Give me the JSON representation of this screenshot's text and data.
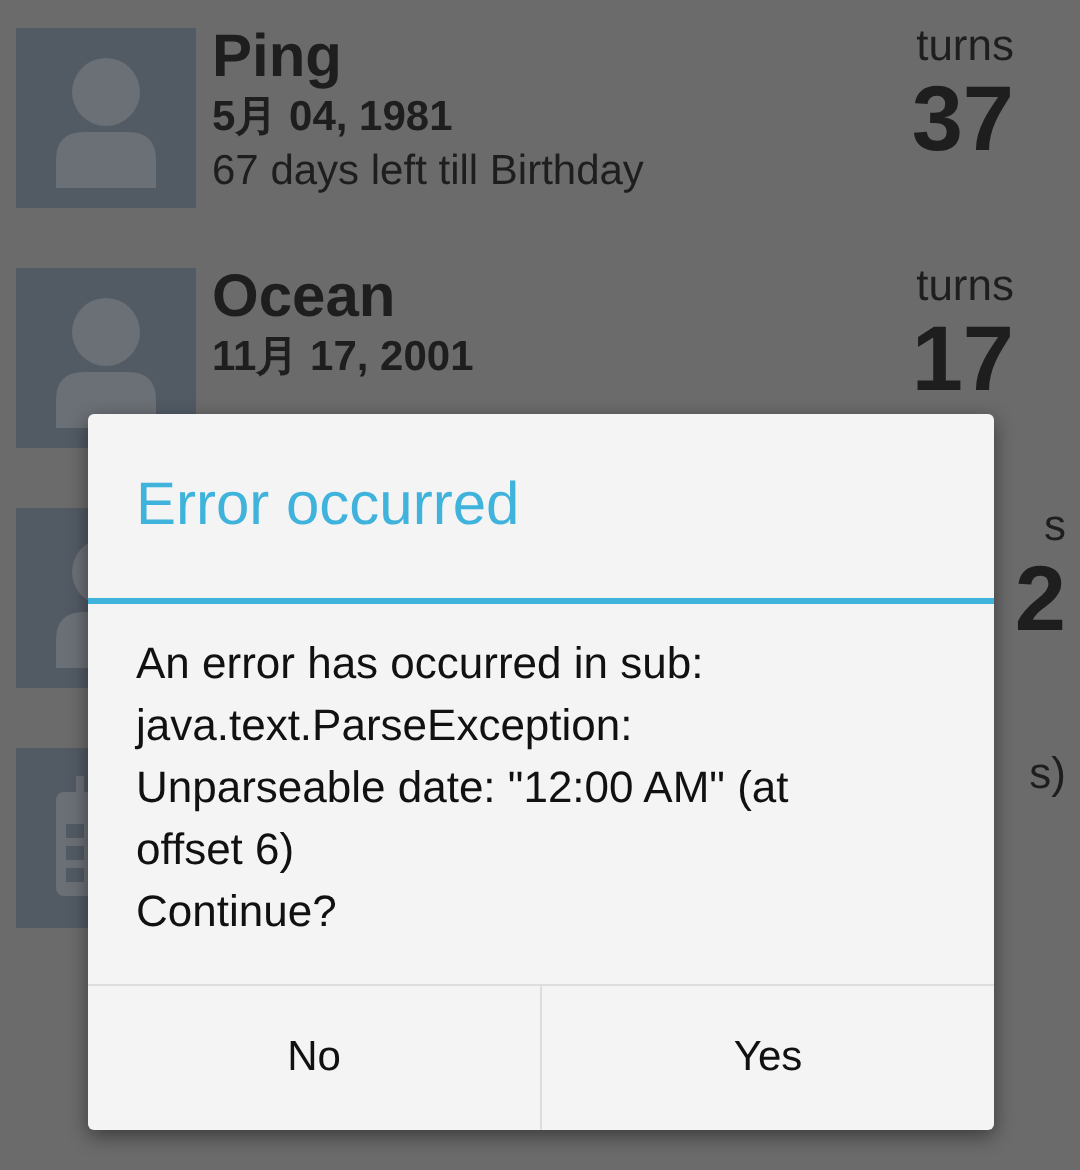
{
  "contacts": [
    {
      "kind": "person",
      "name": "Ping",
      "date": "5月 04, 1981",
      "countdown": "67 days left till Birthday",
      "turns_label": "turns",
      "turns": "37"
    },
    {
      "kind": "person",
      "name": "Ocean",
      "date": "11月 17, 2001",
      "turns_label": "turns",
      "turns": "17"
    },
    {
      "kind": "person",
      "turns_label": "s",
      "turns": "2"
    },
    {
      "kind": "calendar",
      "side_text": "s)"
    }
  ],
  "dialog": {
    "title": "Error occurred",
    "message": "An error has occurred in sub:\njava.text.ParseException:\nUnparseable date: \"12:00 AM\" (at\noffset 6)\nContinue?",
    "buttons": [
      "No",
      "Yes"
    ]
  }
}
